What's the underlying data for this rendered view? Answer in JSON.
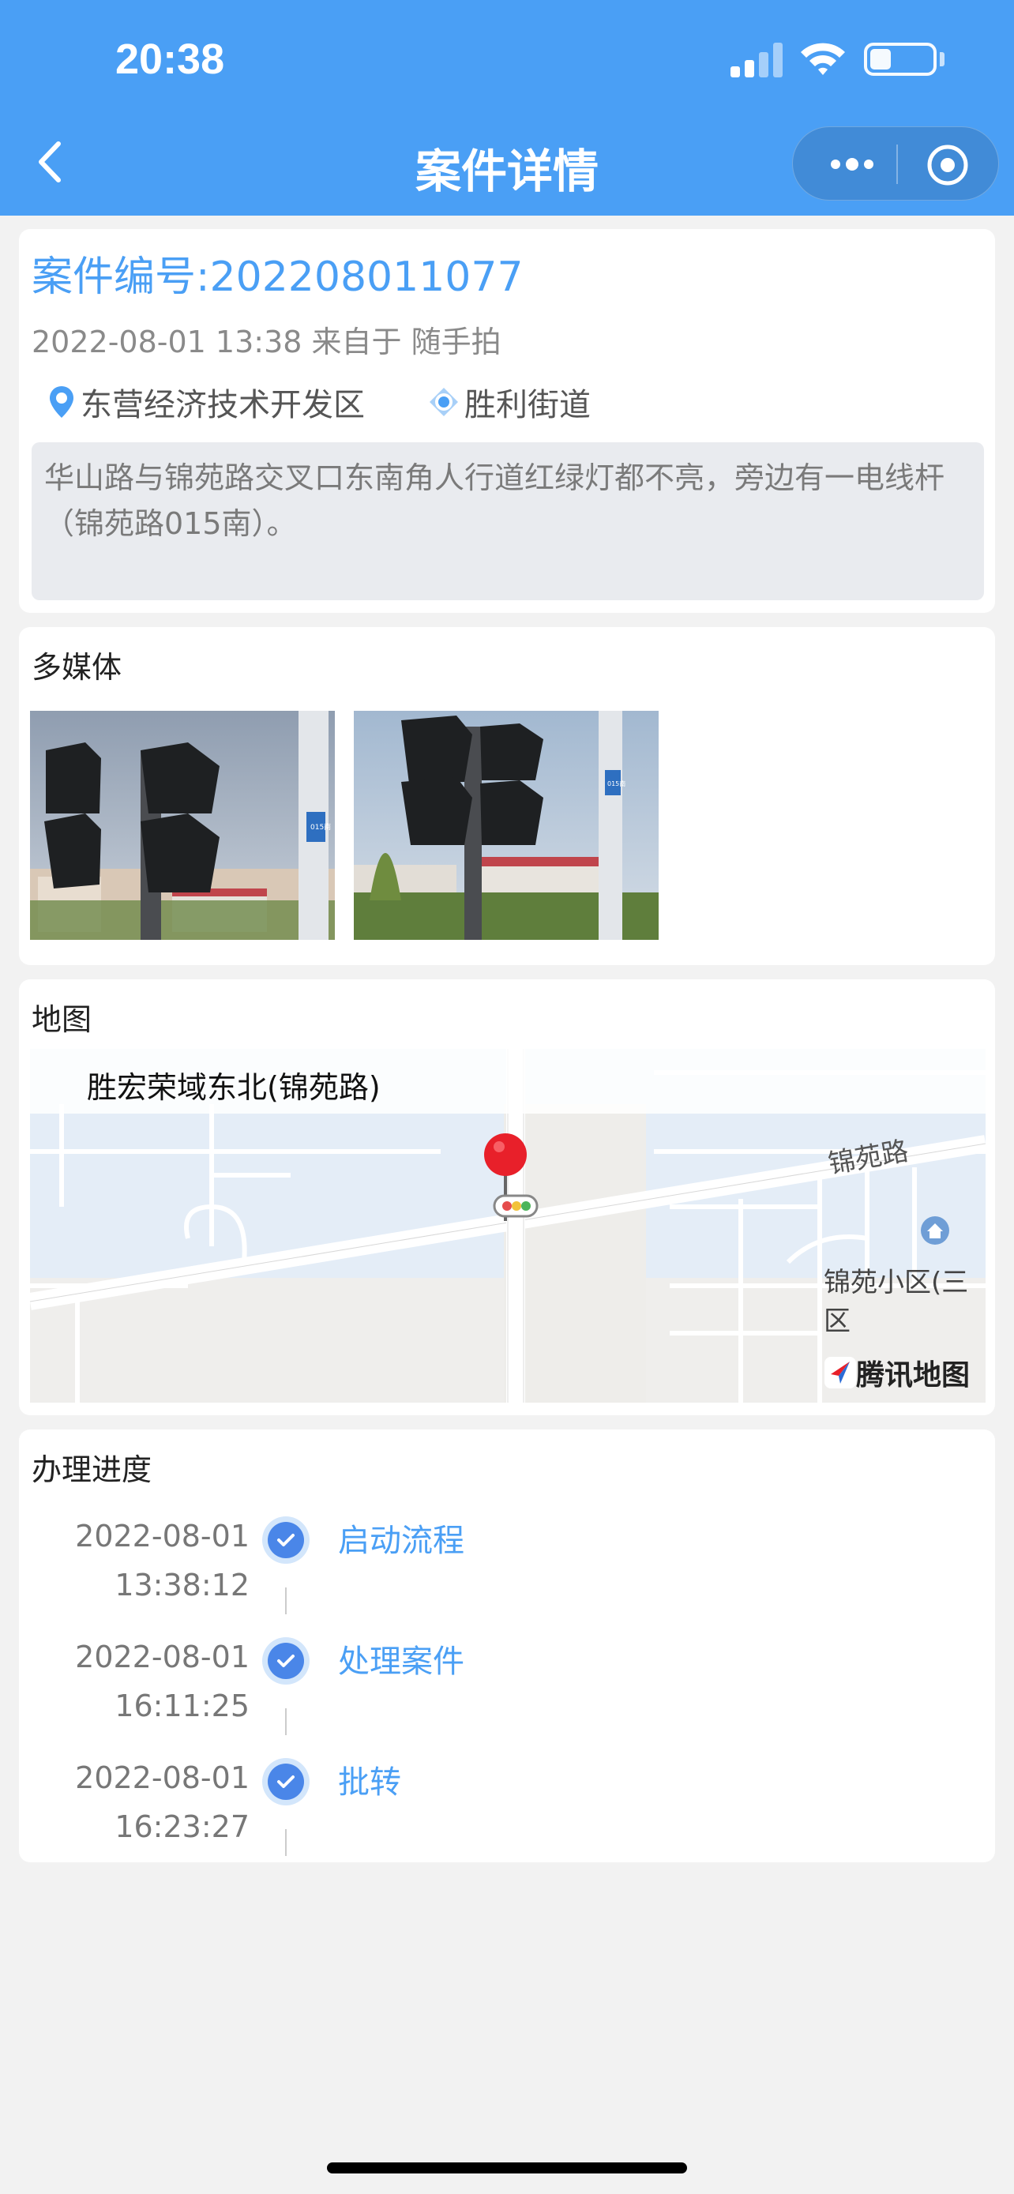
{
  "status_bar": {
    "time": "20:38"
  },
  "nav": {
    "title": "案件详情"
  },
  "case": {
    "number_line": "案件编号:202208011077",
    "meta": "2022-08-01 13:38 来自于 随手拍",
    "district": "东营经济技术开发区",
    "street": "胜利街道",
    "description": "华山路与锦苑路交叉口东南角人行道红绿灯都不亮，旁边有一电线杆（锦苑路015南）。"
  },
  "media": {
    "title": "多媒体",
    "photos": [
      {
        "icon": "traffic-light-photo",
        "sign_text": "015南"
      },
      {
        "icon": "traffic-light-photo",
        "sign_text": "015南"
      }
    ]
  },
  "map": {
    "title": "地图",
    "place_label": "胜宏荣域东北(锦苑路)",
    "road_label": "锦苑路",
    "poi_label": "锦苑小区(三区",
    "provider": "腾讯地图"
  },
  "progress": {
    "title": "办理进度",
    "steps": [
      {
        "date": "2022-08-01",
        "time": "13:38:12",
        "label": "启动流程"
      },
      {
        "date": "2022-08-01",
        "time": "16:11:25",
        "label": "处理案件"
      },
      {
        "date": "2022-08-01",
        "time": "16:23:27",
        "label": "批转"
      }
    ]
  },
  "colors": {
    "header": "#4a9ff5",
    "accent": "#4a9ff5",
    "check": "#4a86e8"
  }
}
